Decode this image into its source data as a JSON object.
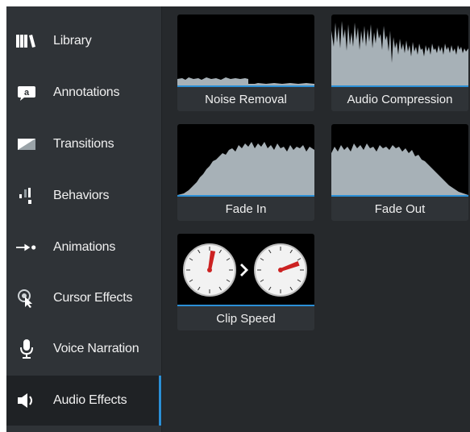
{
  "sidebar": {
    "items": [
      {
        "label": "Library",
        "icon": "library-icon"
      },
      {
        "label": "Annotations",
        "icon": "annotations-icon"
      },
      {
        "label": "Transitions",
        "icon": "transitions-icon"
      },
      {
        "label": "Behaviors",
        "icon": "behaviors-icon"
      },
      {
        "label": "Animations",
        "icon": "animations-icon"
      },
      {
        "label": "Cursor Effects",
        "icon": "cursor-effects-icon"
      },
      {
        "label": "Voice Narration",
        "icon": "microphone-icon"
      },
      {
        "label": "Audio Effects",
        "icon": "speaker-icon",
        "active": true
      }
    ]
  },
  "effects": {
    "tiles": [
      {
        "label": "Noise Removal"
      },
      {
        "label": "Audio Compression"
      },
      {
        "label": "Fade In"
      },
      {
        "label": "Fade Out"
      },
      {
        "label": "Clip Speed"
      }
    ]
  },
  "colors": {
    "accent": "#2b8fd6",
    "sidebar_bg": "#2f3337",
    "panel_bg": "#26292c",
    "waveform": "#a7b1b7",
    "clock_hand": "#cc2222"
  }
}
